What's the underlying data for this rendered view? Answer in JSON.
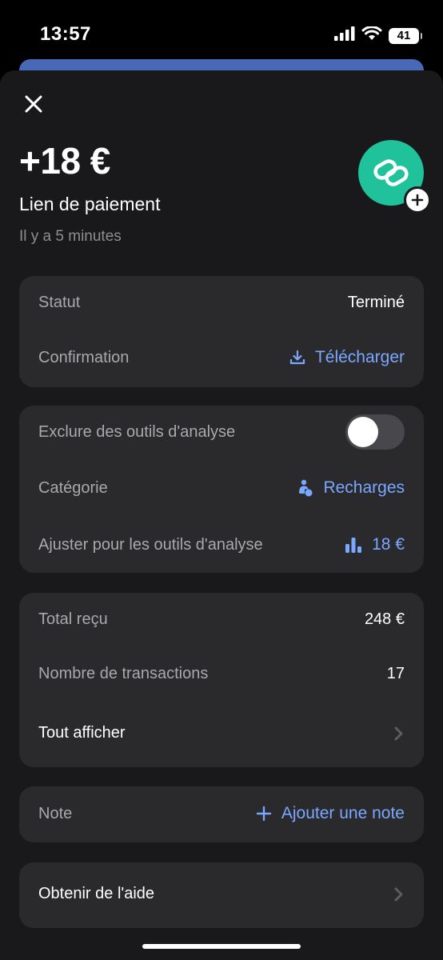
{
  "status_bar": {
    "time": "13:57",
    "battery": "41",
    "icons": [
      "signal-icon",
      "wifi-icon",
      "battery-icon"
    ]
  },
  "header": {
    "amount": "+18 €",
    "title": "Lien de paiement",
    "time_ago": "Il y a 5 minutes",
    "avatar_icon": "link-icon",
    "avatar_color": "#1fc29b"
  },
  "card_status": {
    "status_label": "Statut",
    "status_value": "Terminé",
    "confirmation_label": "Confirmation",
    "download_label": "Télécharger"
  },
  "card_analytics": {
    "exclude_label": "Exclure des outils d'analyse",
    "exclude_enabled": false,
    "category_label": "Catégorie",
    "category_value": "Recharges",
    "adjust_label": "Ajuster pour les outils d'analyse",
    "adjust_value": "18 €"
  },
  "card_totals": {
    "total_label": "Total reçu",
    "total_value": "248 €",
    "count_label": "Nombre de transactions",
    "count_value": "17",
    "show_all_label": "Tout afficher"
  },
  "card_note": {
    "note_label": "Note",
    "add_note_label": "Ajouter une note"
  },
  "card_help": {
    "help_label": "Obtenir de l'aide"
  },
  "colors": {
    "accent": "#7aa7ff",
    "background": "#19191b",
    "card": "#2a2a2d"
  }
}
